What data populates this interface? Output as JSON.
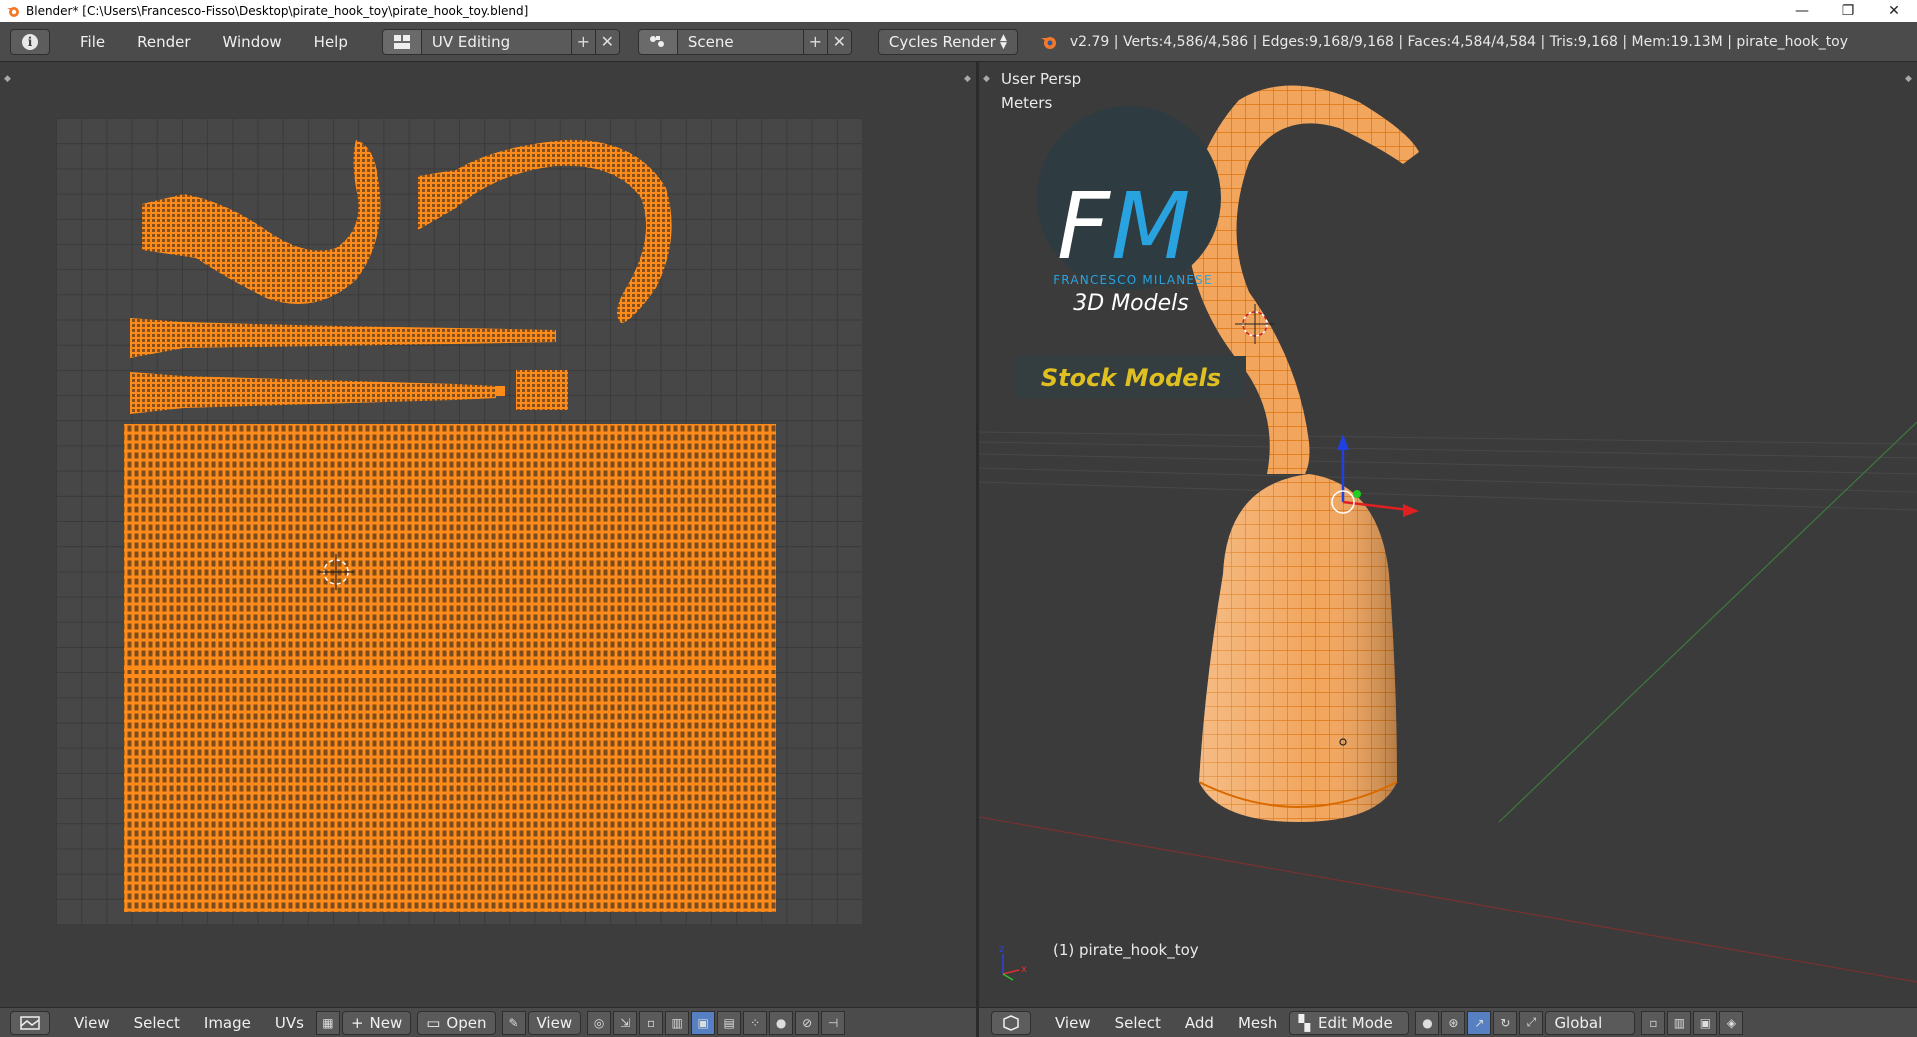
{
  "window": {
    "title": "Blender* [C:\\Users\\Francesco-Fisso\\Desktop\\pirate_hook_toy\\pirate_hook_toy.blend]",
    "minimize": "—",
    "restore": "❐",
    "close": "✕"
  },
  "topbar": {
    "menus": [
      "File",
      "Render",
      "Window",
      "Help"
    ],
    "layout": "UV Editing",
    "scene": "Scene",
    "engine": "Cycles Render",
    "stats": "v2.79 | Verts:4,586/4,586 | Edges:9,168/9,168 | Faces:4,584/4,584 | Tris:9,168 | Mem:19.13M | pirate_hook_toy"
  },
  "viewport": {
    "view_name": "User Persp",
    "units": "Meters",
    "object_label": "(1) pirate_hook_toy"
  },
  "watermark": {
    "logo_letters": "FM",
    "brand": "FRANCESCO MILANESE",
    "tagline": "3D Models",
    "stock": "Stock Models"
  },
  "uv_footer": {
    "menus": [
      "View",
      "Select",
      "Image",
      "UVs"
    ],
    "new": "New",
    "open": "Open",
    "view": "View"
  },
  "view3d_footer": {
    "menus": [
      "View",
      "Select",
      "Add",
      "Mesh"
    ],
    "mode": "Edit Mode",
    "orientation": "Global"
  },
  "colors": {
    "mesh_orange": "#ff8c1a",
    "accent_blue": "#29a3e0",
    "stock_yellow": "#e0c020"
  }
}
